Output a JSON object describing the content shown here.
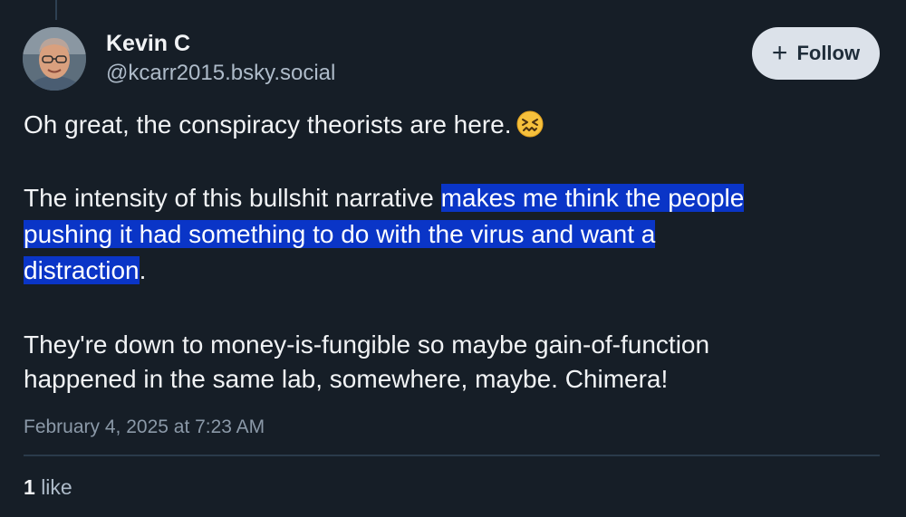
{
  "author": {
    "display_name": "Kevin C",
    "handle": "@kcarr2015.bsky.social"
  },
  "follow_button": {
    "icon": "plus-icon",
    "label": "Follow"
  },
  "post": {
    "paragraph1": "Oh great, the conspiracy theorists are here.",
    "paragraph1_emoji": "confounded-face-emoji",
    "paragraph2": {
      "line1_plain": "The intensity of this bullshit narrative ",
      "line1_highlight": "makes me think the people",
      "line2_highlight": "pushing it had something to do with the virus and want a",
      "line3_highlight": "distraction",
      "line3_plain": "."
    },
    "paragraph3": {
      "line1": "They're down to money-is-fungible so maybe gain-of-function",
      "line2": "happened in the same lab, somewhere, maybe. Chimera!"
    },
    "timestamp": "February 4, 2025 at 7:23 AM"
  },
  "stats": {
    "like_count": "1",
    "like_label": "like"
  },
  "colors": {
    "background": "#161e27",
    "highlight": "#0a35c7",
    "follow_bg": "#dce2ea"
  }
}
